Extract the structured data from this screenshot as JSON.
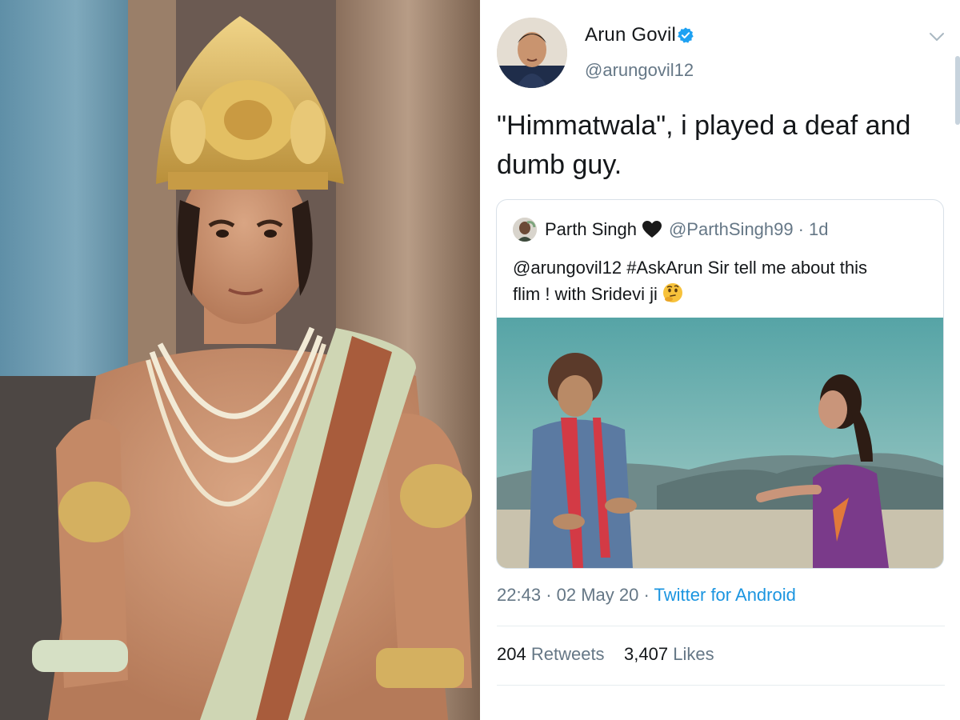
{
  "tweet": {
    "author_name": "Arun Govil",
    "author_handle": "@arungovil12",
    "text_line1": "\"Himmatwala\", i played a deaf and",
    "text_line2": "dumb guy.",
    "timestamp_time": "22:43",
    "timestamp_date": "02 May 20",
    "source": "Twitter for Android",
    "retweets_count": "204",
    "retweets_label": "Retweets",
    "likes_count": "3,407",
    "likes_label": "Likes"
  },
  "quoted_tweet": {
    "author_name": "Parth Singh",
    "author_handle": "@ParthSingh99",
    "age": "1d",
    "text_line1": "@arungovil12  #AskArun Sir tell me about this",
    "text_line2": "flim  ! with Sridevi ji",
    "emoji": "thinking-face-emoji"
  },
  "icons": {
    "verified": "verified-badge-icon",
    "menu": "chevron-down-icon",
    "heart": "black-heart-icon"
  },
  "colors": {
    "link_blue": "#1b95e0",
    "verified_blue": "#1da1f2",
    "text_primary": "#14171a",
    "text_secondary": "#657786",
    "border": "#d9e1e8"
  }
}
